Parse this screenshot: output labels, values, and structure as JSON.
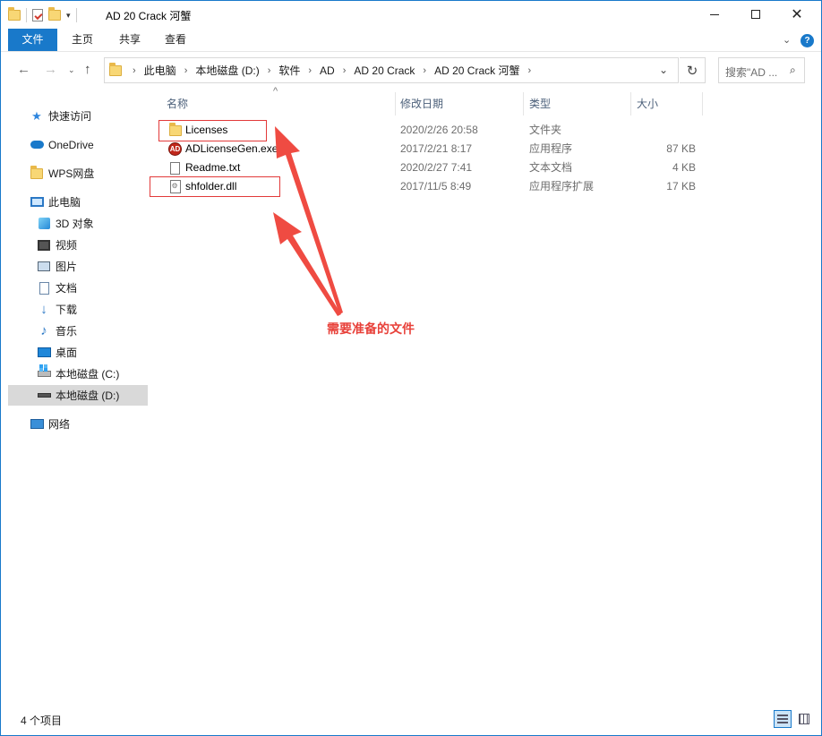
{
  "window": {
    "title": "AD 20 Crack 河蟹",
    "minimize_label": "",
    "maximize_label": "",
    "close_label": "✕"
  },
  "ribbon": {
    "tabs": [
      {
        "label": "文件",
        "active": true
      },
      {
        "label": "主页"
      },
      {
        "label": "共享"
      },
      {
        "label": "查看"
      }
    ],
    "help_label": "?",
    "accent_color": "#1979ca"
  },
  "address": {
    "crumbs": [
      "此电脑",
      "本地磁盘 (D:)",
      "软件",
      "AD",
      "AD 20 Crack",
      "AD 20 Crack 河蟹"
    ]
  },
  "search": {
    "placeholder": "搜索\"AD ..."
  },
  "navigation": {
    "items": [
      {
        "label": "快速访问",
        "icon": "star-icon"
      },
      {
        "label": "OneDrive",
        "icon": "cloud-icon"
      },
      {
        "label": "WPS网盘",
        "icon": "folder-icon"
      },
      {
        "label": "此电脑",
        "icon": "computer-icon"
      },
      {
        "label": "3D 对象",
        "icon": "cube-icon"
      },
      {
        "label": "视频",
        "icon": "video-icon"
      },
      {
        "label": "图片",
        "icon": "picture-icon"
      },
      {
        "label": "文档",
        "icon": "document-icon"
      },
      {
        "label": "下载",
        "icon": "download-icon"
      },
      {
        "label": "音乐",
        "icon": "music-icon"
      },
      {
        "label": "桌面",
        "icon": "desktop-icon"
      },
      {
        "label": "本地磁盘 (C:)",
        "icon": "drive-icon"
      },
      {
        "label": "本地磁盘 (D:)",
        "icon": "drive-icon",
        "selected": true
      },
      {
        "label": "网络",
        "icon": "network-icon"
      }
    ]
  },
  "columns": {
    "name": "名称",
    "date": "修改日期",
    "type": "类型",
    "size": "大小"
  },
  "files": [
    {
      "name": "Licenses",
      "date": "2020/2/26 20:58",
      "type": "文件夹",
      "size": "",
      "icon": "folder-icon"
    },
    {
      "name": "ADLicenseGen.exe",
      "date": "2017/2/21 8:17",
      "type": "应用程序",
      "size": "87 KB",
      "icon": "exe-icon"
    },
    {
      "name": "Readme.txt",
      "date": "2020/2/27 7:41",
      "type": "文本文档",
      "size": "4 KB",
      "icon": "text-file-icon"
    },
    {
      "name": "shfolder.dll",
      "date": "2017/11/5 8:49",
      "type": "应用程序扩展",
      "size": "17 KB",
      "icon": "dll-file-icon"
    }
  ],
  "annotation": {
    "text": "需要准备的文件",
    "color": "#e8413a"
  },
  "status": {
    "item_count": "4 个项目"
  }
}
